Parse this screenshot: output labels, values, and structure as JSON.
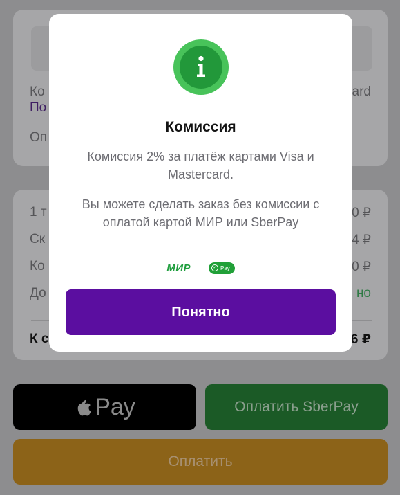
{
  "background": {
    "top_card": {
      "row1_left": "Ко",
      "row1_right": "ard",
      "row2_left": "По",
      "row3_left": "Оп"
    },
    "summary_card": {
      "rows": [
        {
          "left": "1 т",
          "right": "0 ₽"
        },
        {
          "left": "Ск",
          "right": "4 ₽"
        },
        {
          "left": "Ко",
          "right": "0 ₽"
        },
        {
          "left": "До",
          "right": "но"
        }
      ],
      "total_left": "К с",
      "total_right": "6 ₽"
    },
    "apple_pay_label": "Pay",
    "sberpay_button_label": "Оплатить SberPay",
    "pay_button_label": "Оплатить"
  },
  "modal": {
    "icon": "info-icon",
    "title": "Комиссия",
    "paragraph1": "Комиссия 2% за платёж картами Visa и Mastercard.",
    "paragraph2": "Вы можете сделать заказ без комиссии с оплатой картой МИР или SberPay",
    "mir_logo_text": "МИР",
    "sberpay_logo_text": "Pay",
    "button_label": "Понятно"
  },
  "colors": {
    "accent_purple": "#5b0ea0",
    "info_green": "#22983a",
    "sber_green": "#21a038"
  }
}
